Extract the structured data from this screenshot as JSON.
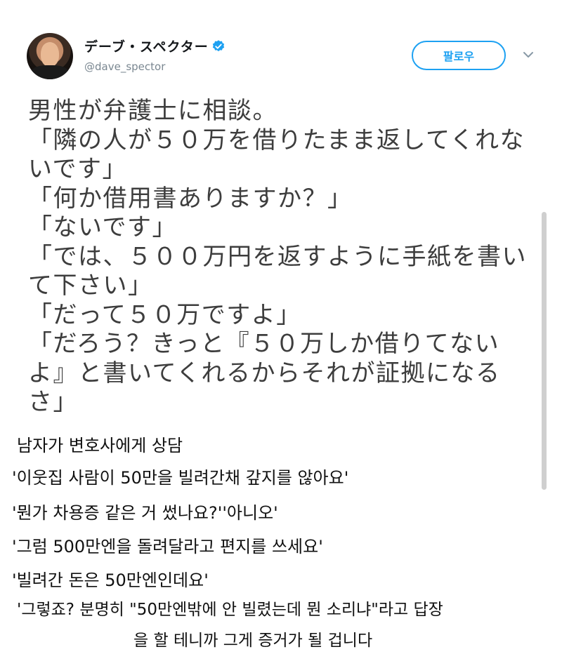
{
  "tweet": {
    "display_name": "デーブ・スペクター",
    "handle": "@dave_spector",
    "follow_label": "팔로우",
    "lines": [
      "男性が弁護士に相談。",
      "「隣の人が５０万を借りたまま返してくれな",
      "いです」",
      "「何か借用書ありますか？」",
      "「ないです」",
      "「では、５００万円を返すように手紙を書い",
      "て下さい」",
      "「だって５０万ですよ」",
      "「だろう？きっと『５０万しか借りてない",
      "よ』と書いてくれるからそれが証拠になる",
      "さ」"
    ]
  },
  "translation": {
    "lines": [
      "남자가 변호사에게 상담",
      "'이웃집 사람이 50만을 빌려간채 갚지를 않아요'",
      "'뭔가 차용증 같은 거 썼나요?''아니오'",
      "'그럼 500만엔을 돌려달라고 편지를 쓰세요'",
      "'빌려간 돈은 50만엔인데요'",
      "'그렇죠? 분명히 \"50만엔밖에 안 빌렸는데 뭔 소리냐\"라고 답장",
      "을 할 테니까 그게 증거가 될 겁니다"
    ]
  },
  "colors": {
    "accent": "#1da1f2",
    "verified": "#1da1f2"
  }
}
